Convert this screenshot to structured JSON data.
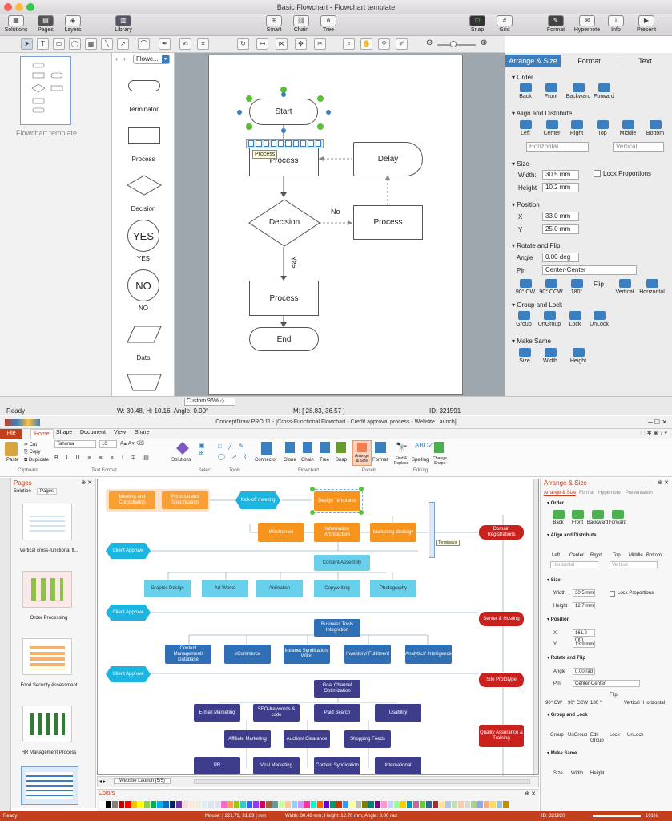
{
  "top_app": {
    "window_title": "Basic Flowchart - Flowchart template",
    "toolbar_left": [
      "Solutions",
      "Pages",
      "Layers"
    ],
    "toolbar_library": "Library",
    "toolbar_mid": [
      "Smart",
      "Chain",
      "Tree"
    ],
    "toolbar_snap": [
      "Snap",
      "Grid"
    ],
    "toolbar_right": [
      "Format",
      "Hypernote",
      "Info",
      "Present"
    ],
    "page_thumb_caption": "Flowchart template",
    "library_dropdown": "Flowc...",
    "library_items": [
      "Terminator",
      "Process",
      "Decision",
      "YES",
      "NO",
      "Data"
    ],
    "yes_glyph": "YES",
    "no_glyph": "NO",
    "diagram": {
      "start": "Start",
      "process1": "Process",
      "tooltip": "Process",
      "delay": "Delay",
      "decision": "Decision",
      "no_label": "No",
      "process2": "Process",
      "yes_label": "Yes",
      "process3": "Process",
      "end": "End"
    },
    "right_tabs": [
      "Arrange & Size",
      "Format",
      "Text"
    ],
    "order": {
      "title": "Order",
      "items": [
        "Back",
        "Front",
        "Backward",
        "Forward"
      ]
    },
    "align": {
      "title": "Align and Distribute",
      "items": [
        "Left",
        "Center",
        "Right",
        "Top",
        "Middle",
        "Bottom"
      ],
      "horizontal": "Horizontal",
      "vertical": "Vertical"
    },
    "size": {
      "title": "Size",
      "width_label": "Width:",
      "width": "30.5 mm",
      "height_label": "Height",
      "height": "10.2 mm",
      "lock": "Lock Proportions"
    },
    "position": {
      "title": "Position",
      "x_label": "X",
      "x": "33.0 mm",
      "y_label": "Y",
      "y": "25.0 mm"
    },
    "rotate": {
      "title": "Rotate and Flip",
      "angle_label": "Angle",
      "angle": "0.00 deg",
      "pin_label": "Pin",
      "pin": "Center-Center",
      "buttons": [
        "90° CW",
        "90° CCW",
        "180°"
      ],
      "flip": "Flip",
      "flip_buttons": [
        "Vertical",
        "Horizontal"
      ]
    },
    "group": {
      "title": "Group and Lock",
      "items": [
        "Group",
        "UnGroup",
        "Lock",
        "UnLock"
      ]
    },
    "same": {
      "title": "Make Same",
      "items": [
        "Size",
        "Width",
        "Height"
      ]
    },
    "zoom": "Custom 96%",
    "status": {
      "ready": "Ready",
      "dims": "W: 30.48,  H: 10.16,  Angle: 0.00°",
      "mouse": "M: [ 28.83, 36.57 ]",
      "id": "ID: 321591"
    }
  },
  "bottom_app": {
    "window_title": "ConceptDraw PRO 11 - [Cross-Functional Flowchart - Credit approval process - Website Launch]",
    "menu": [
      "File",
      "Home",
      "Shape",
      "Document",
      "View",
      "Share"
    ],
    "font_name": "Tahoma",
    "font_size": "10",
    "clip": [
      "Paste",
      "Cut",
      "Copy",
      "Duplicate"
    ],
    "ribbon_buttons": [
      "Solutions",
      "Connector",
      "Clone",
      "Chain",
      "Tree",
      "Snap",
      "Arrange & Size",
      "Format",
      "Find & Replace",
      "Spelling",
      "Change Shape"
    ],
    "ribbon_groups": [
      "Clipboard",
      "Text Format",
      "Select",
      "Tools",
      "Flowchart",
      "Panels",
      "Editing"
    ],
    "pages_title": "Pages",
    "pages_tabs": [
      "Solution",
      "Pages"
    ],
    "page_thumbs": [
      "Vertical cross-functional fl...",
      "Order Processing",
      "Food Security Assessment",
      "HR Management Process"
    ],
    "nodes": {
      "meeting": "Meeting and Consultation",
      "proposal": "Proposal and Specification",
      "kickoff": "Kick-off meeting",
      "design": "Design Templates",
      "wireframes": "Wireframes",
      "info_arch": "Information Architecture",
      "marketing": "Marketing Strategy",
      "domain": "Domain Registrations",
      "client1": "Client Approve",
      "content_assembly": "Content Assembly",
      "graphic": "Graphic Design",
      "artworks": "Art Works",
      "animation": "Animation",
      "copywriting": "Copywriting",
      "photography": "Photography",
      "client2": "Client Approve",
      "server": "Server & Hosting",
      "bti": "Business Tools Integration",
      "cmd": "Content Management/ Database",
      "ecommerce": "eCommerce",
      "intranet": "Intranet Syndication/ Wikis",
      "inventory": "Inventory/ Fulfilment",
      "analytics": "Analytics/ Intelligence",
      "client3": "Client Approve",
      "site": "Site Prototype",
      "goal": "Goal Channel Optimization",
      "email": "E-mail Marketing",
      "seo": "SEO-Keywords & code",
      "paid": "Paid Search",
      "usability": "Usability",
      "affiliate": "Affiliate Marketing",
      "auction": "Auction/ Clearance",
      "shopping": "Shopping Feeds",
      "qa": "Quality Assurance & Training",
      "pr": "PR",
      "viral": "Viral Marketing",
      "content_synd": "Content Syndication",
      "international": "International",
      "tooltip": "Terminator"
    },
    "sheet_tab": "Website Launch (5/5)",
    "colors_title": "Colors",
    "right_title": "Arrange & Size",
    "right_tabs": [
      "Arrange & Size",
      "Format",
      "Hypernote",
      "Presentation"
    ],
    "order": {
      "title": "Order",
      "items": [
        "Back",
        "Front",
        "Backward",
        "Forward"
      ]
    },
    "align": {
      "title": "Align and Distribute",
      "items": [
        "Left",
        "Center",
        "Right",
        "Top",
        "Middle",
        "Bottom"
      ],
      "horizontal": "Horizontal",
      "vertical": "Vertical"
    },
    "size": {
      "title": "Size",
      "width_label": "Width",
      "width": "30.5 mm",
      "height_label": "Height",
      "height": "12.7 mm",
      "lock": "Lock Proportions"
    },
    "position": {
      "title": "Position",
      "x_label": "X",
      "x": "161.2 mm",
      "y_label": "Y",
      "y": "13.9 mm"
    },
    "rotate": {
      "title": "Rotate and Flip",
      "angle_label": "Angle",
      "angle": "0.00 rad",
      "pin_label": "Pin",
      "pin": "Center-Center",
      "buttons": [
        "90° CW",
        "90° CCW",
        "180 °"
      ],
      "flip": "Flip",
      "flip_buttons": [
        "Vertical",
        "Horizontal"
      ]
    },
    "group": {
      "title": "Group and Lock",
      "items": [
        "Group",
        "UnGroup",
        "Edit Group",
        "Lock",
        "UnLock"
      ]
    },
    "same": {
      "title": "Make Same",
      "items": [
        "Size",
        "Width",
        "Height"
      ]
    },
    "status": {
      "ready": "Ready",
      "mouse": "Mouse: [ 221.79, 31.83 ] mm",
      "dims": "Width: 30.48 mm; Height: 12.70 mm; Angle: 0.00 rad",
      "id": "ID: 321920",
      "zoom": "101%"
    }
  },
  "colors": {
    "accent_blue": "#3c7fc1",
    "office_red": "#c3401f",
    "node_orange": "#f7941d",
    "node_cyan": "#69d0ec",
    "node_blue": "#2e6fb5",
    "node_navy": "#3d3d8c",
    "node_red": "#c9211e",
    "hex_blue": "#1cb5e0"
  }
}
